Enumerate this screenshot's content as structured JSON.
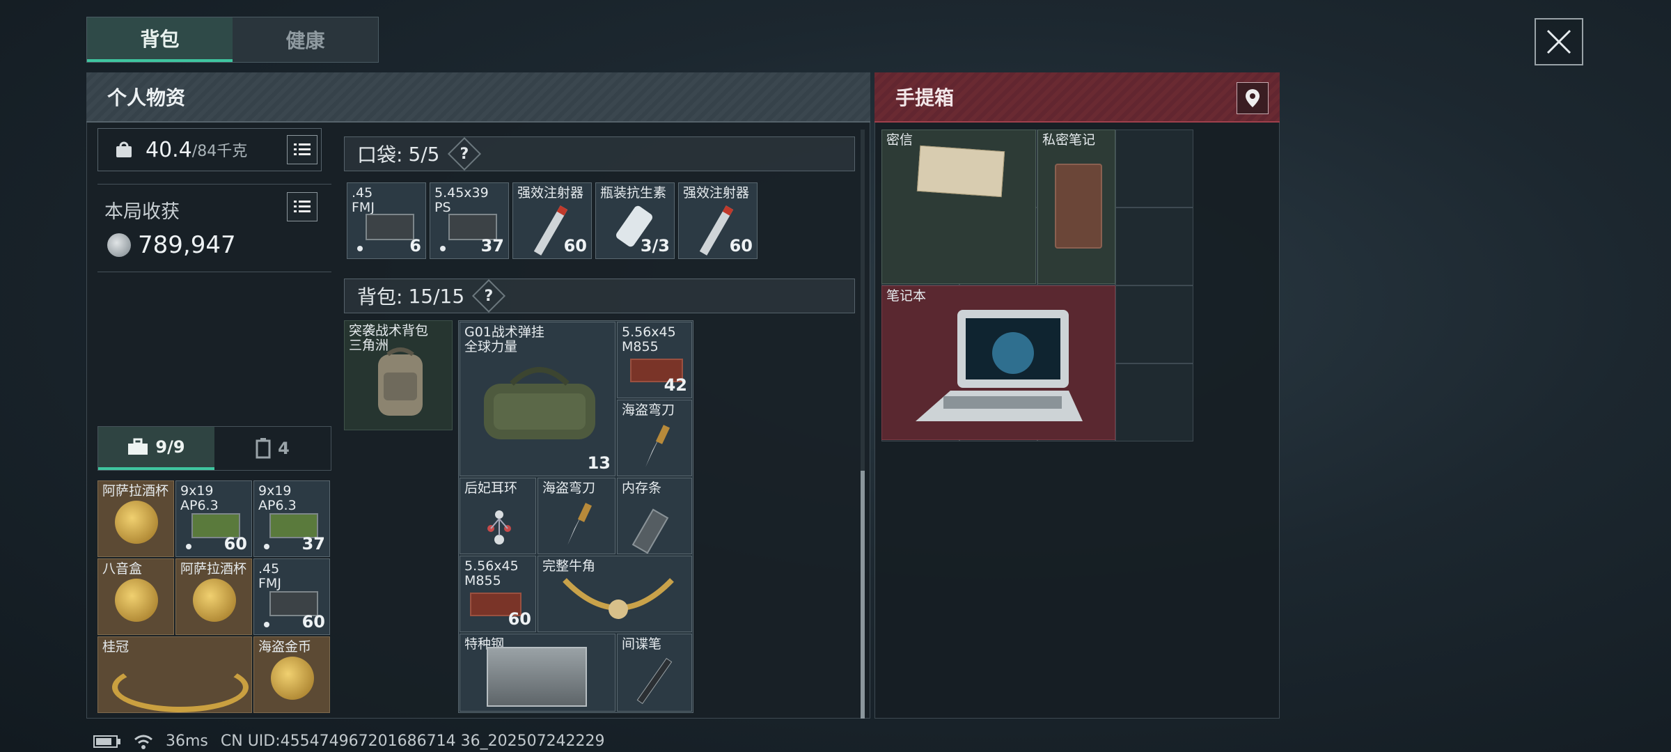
{
  "tabs": {
    "backpack": "背包",
    "health": "健康"
  },
  "close_icon": "close-icon",
  "left_panel": {
    "title": "个人物资",
    "weight_value": "40.4",
    "weight_unit": "/84千克",
    "income_label": "本局收获",
    "income_value": "789,947"
  },
  "bottom_tabs": {
    "toolbox_count": "9/9",
    "container_count": "4"
  },
  "pocket": {
    "label": "口袋:",
    "count": "5/5",
    "help": "?",
    "items": [
      {
        "name": ".45\nFMJ",
        "count": "6"
      },
      {
        "name": "5.45x39\nPS",
        "count": "37"
      },
      {
        "name": "强效注射器",
        "count": "60"
      },
      {
        "name": "瓶装抗生素",
        "count": "3/3"
      },
      {
        "name": "强效注射器",
        "count": "60"
      }
    ]
  },
  "bag": {
    "label": "背包:",
    "count": "15/15",
    "help": "?",
    "item_bag": "突袭战术背包\n三角洲",
    "items": {
      "rig": "G01战术弹挂\n全球力量",
      "rig_count": "13",
      "ammo1": "5.56x45\nM855",
      "ammo1_count": "42",
      "knife1": "海盗弯刀",
      "earring": "后妃耳环",
      "knife2": "海盗弯刀",
      "ram": "内存条",
      "ammo2": "5.56x45\nM855",
      "ammo2_count": "60",
      "horn": "完整牛角",
      "steel": "特种钢",
      "pen": "间谍笔"
    }
  },
  "safebox": {
    "items": [
      {
        "name": "阿萨拉酒杯",
        "count": ""
      },
      {
        "name": "9x19\nAP6.3",
        "count": "60"
      },
      {
        "name": "9x19\nAP6.3",
        "count": "37"
      },
      {
        "name": "八音盒",
        "count": ""
      },
      {
        "name": "阿萨拉酒杯",
        "count": ""
      },
      {
        "name": ".45\nFMJ",
        "count": "60"
      },
      {
        "name": "桂冠",
        "count": ""
      },
      {
        "name": "海盗金币",
        "count": ""
      }
    ]
  },
  "right_panel": {
    "title": "手提箱",
    "letter": "密信",
    "notes": "私密笔记",
    "laptop": "笔记本"
  },
  "status": {
    "ping": "36ms",
    "uid": "CN UID:455474967201686714 36_202507242229"
  }
}
